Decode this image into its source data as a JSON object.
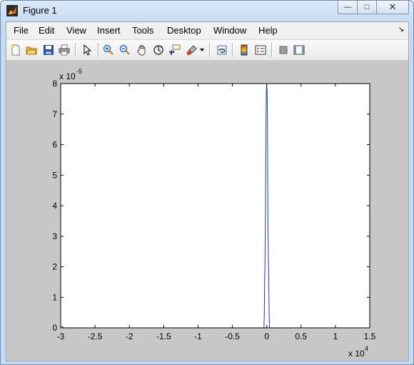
{
  "window": {
    "title": "Figure 1"
  },
  "menu": [
    "File",
    "Edit",
    "View",
    "Insert",
    "Tools",
    "Desktop",
    "Window",
    "Help"
  ],
  "toolbar": [
    "new-figure-icon",
    "open-file-icon",
    "save-icon",
    "print-icon",
    "select-arrow-icon",
    "zoom-in-icon",
    "zoom-out-icon",
    "pan-hand-icon",
    "rotate-3d-icon",
    "data-cursor-icon",
    "brush-icon",
    "link-plot-icon",
    "colorbar-icon",
    "legend-icon",
    "hide-plot-tools-icon",
    "show-plot-tools-icon"
  ],
  "chart_data": {
    "type": "line",
    "x_exponent_label": "x 10",
    "x_exponent": "4",
    "y_exponent_label": "x 10",
    "y_exponent": "-5",
    "xlim": [
      -3,
      1.5
    ],
    "ylim": [
      0,
      8
    ],
    "x_ticks": [
      "-3",
      "-2.5",
      "-2",
      "-1.5",
      "-1",
      "-0.5",
      "0",
      "0.5",
      "1",
      "1.5"
    ],
    "y_ticks": [
      "0",
      "1",
      "2",
      "3",
      "4",
      "5",
      "6",
      "7",
      "8"
    ],
    "series": [
      {
        "color": "#1f3aa8",
        "x": [
          -3,
          -2.95,
          -0.04,
          -0.035,
          -0.03,
          -0.02,
          -0.015,
          -0.01,
          -0.005,
          0,
          0.005,
          0.01,
          0.015,
          0.02,
          0.03,
          0.035,
          0.04,
          0.05,
          1.5
        ],
        "y": [
          0.06,
          0,
          0,
          0.5,
          1.5,
          3,
          4.9,
          6.9,
          7.8,
          7.95,
          7.8,
          6.9,
          4.9,
          3,
          1.5,
          0.5,
          0,
          0,
          0
        ]
      }
    ]
  }
}
